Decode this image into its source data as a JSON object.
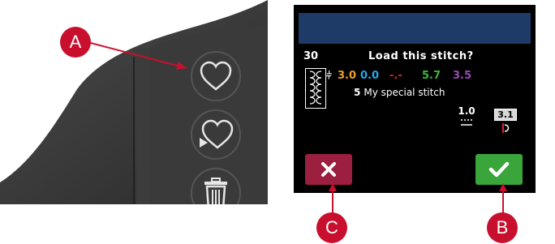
{
  "callouts": {
    "a": "A",
    "b": "B",
    "c": "C"
  },
  "dialog": {
    "stitch_number": "30",
    "title": "Load this stitch?",
    "values": [
      {
        "text": "3.0",
        "color": "#f0a020"
      },
      {
        "text": "0.0",
        "color": "#22a8e8"
      },
      {
        "text": "-.-",
        "color": "#e0202a"
      },
      {
        "text": "5.7",
        "color": "#3ab83a"
      },
      {
        "text": "3.5",
        "color": "#9a4ab8"
      }
    ],
    "stitch_name_number": "5",
    "stitch_name": "My special stitch",
    "stitch_length": "1.0",
    "thread_tension": "3.1"
  },
  "colors": {
    "callout_red": "#c8102e",
    "header_blue": "#1e3a66",
    "cancel": "#9c1f3f",
    "confirm": "#3aa53a"
  }
}
